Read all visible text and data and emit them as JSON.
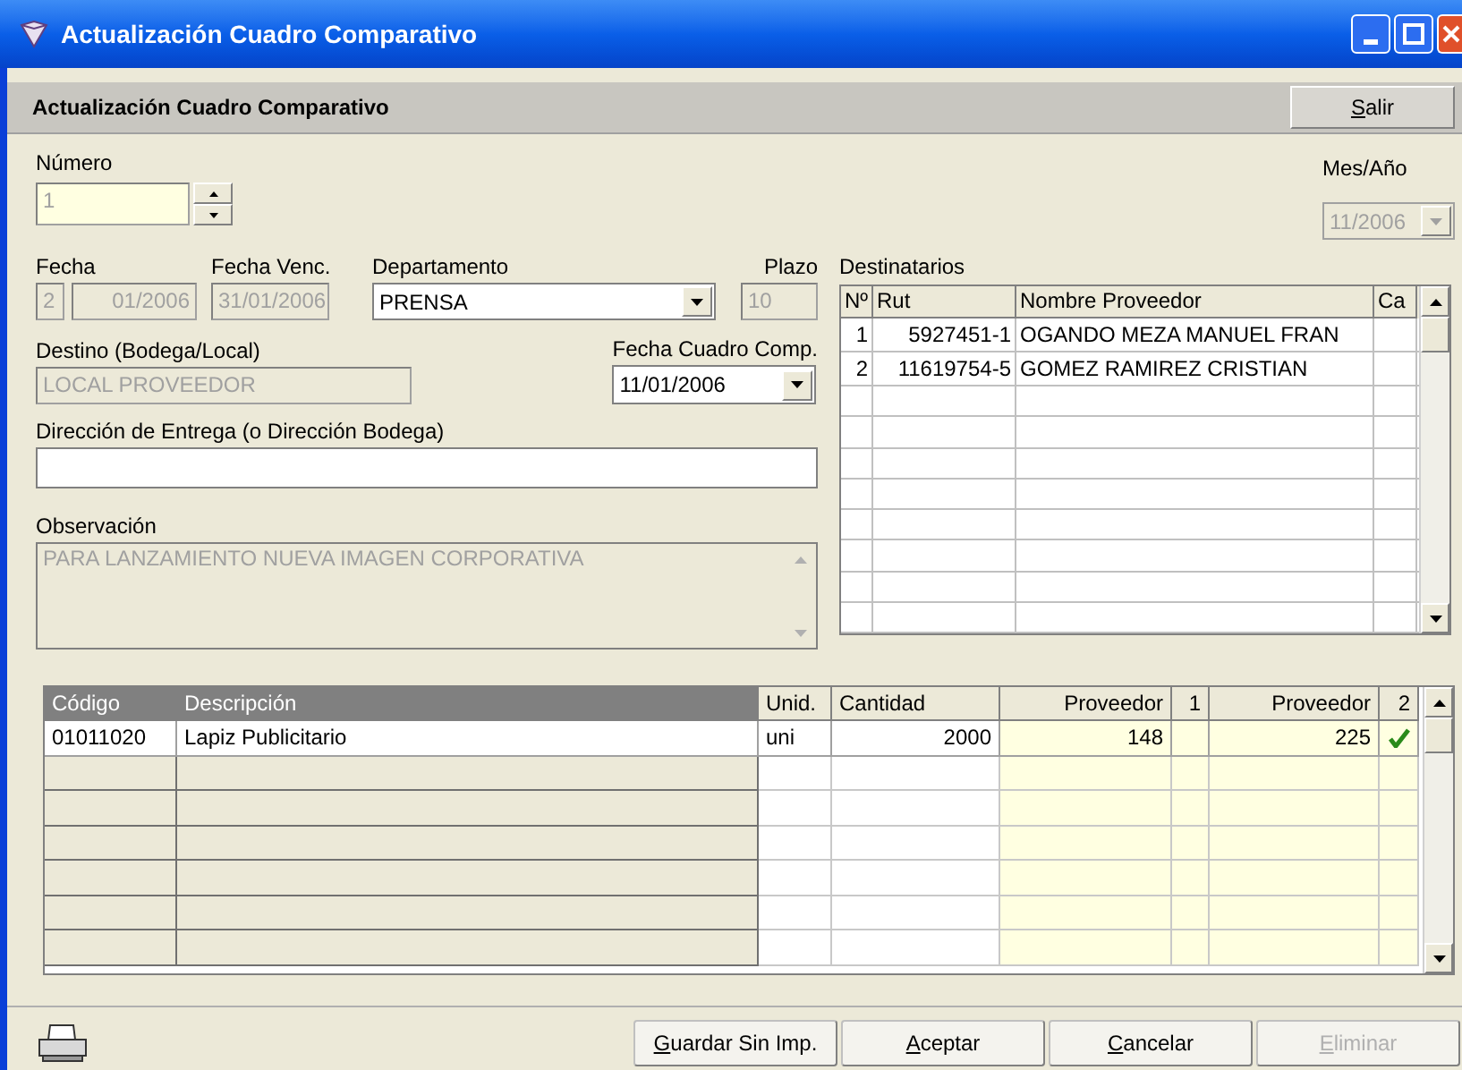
{
  "window": {
    "title": "Actualización Cuadro Comparativo"
  },
  "header": {
    "title": "Actualización Cuadro Comparativo",
    "exit_button": "Salir"
  },
  "numero": {
    "label": "Número",
    "value": "1"
  },
  "mes_ano": {
    "label": "Mes/Año",
    "value": "11/2006"
  },
  "fecha": {
    "label": "Fecha",
    "day": "2",
    "month_year": "01/2006"
  },
  "fecha_venc": {
    "label": "Fecha Venc.",
    "value": "31/01/2006"
  },
  "departamento": {
    "label": "Departamento",
    "value": "PRENSA"
  },
  "plazo": {
    "label": "Plazo",
    "value": "10"
  },
  "destino": {
    "label": "Destino (Bodega/Local)",
    "value": "LOCAL PROVEEDOR"
  },
  "fecha_cuadro": {
    "label": "Fecha Cuadro Comp.",
    "value": "11/01/2006"
  },
  "direccion": {
    "label": "Dirección de Entrega (o Dirección Bodega)"
  },
  "observacion": {
    "label": "Observación",
    "value": "PARA LANZAMIENTO NUEVA IMAGEN CORPORATIVA"
  },
  "destinatarios": {
    "label": "Destinatarios",
    "columns": [
      "Nº",
      "Rut",
      "Nombre Proveedor",
      "Ca"
    ],
    "rows": [
      [
        "1",
        "5927451-1",
        "OGANDO MEZA MANUEL FRAN",
        ""
      ],
      [
        "2",
        "11619754-5",
        "GOMEZ RAMIREZ CRISTIAN",
        ""
      ]
    ]
  },
  "items": {
    "columns": [
      "Código",
      "Descripción",
      "Unid.",
      "Cantidad",
      "Proveedor",
      "1",
      "Proveedor",
      "2"
    ],
    "rows": [
      {
        "code": "01011020",
        "description": "Lapiz Publicitario",
        "unit": "uni",
        "quantity": "2000",
        "supplier_1": "148",
        "supplier_1_checked": false,
        "supplier_2": "225",
        "supplier_2_checked": true
      }
    ]
  },
  "buttons": [
    {
      "label": "Guardar Sin Imp.",
      "disabled": false
    },
    {
      "label": "Aceptar",
      "disabled": false
    },
    {
      "label": "Cancelar",
      "disabled": false
    },
    {
      "label": "Eliminar",
      "disabled": true
    }
  ]
}
